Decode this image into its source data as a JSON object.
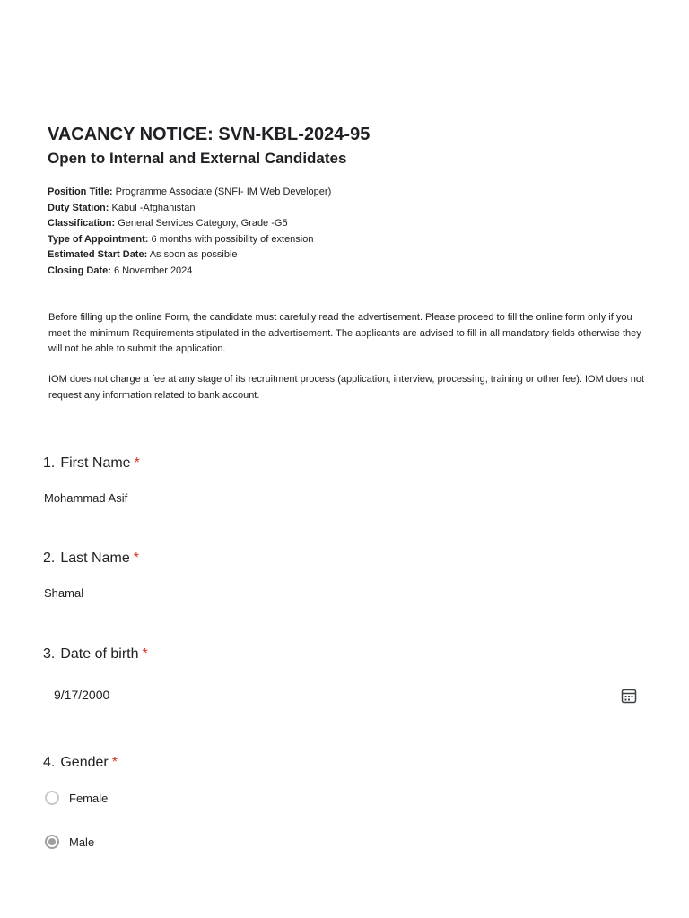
{
  "header": {
    "title_prefix": "VACANCY NOTICE:",
    "title_code": "SVN-KBL-2024-95",
    "subtitle": "Open to Internal and External Candidates"
  },
  "info": [
    {
      "label": "Position Title:",
      "value": "Programme Associate (SNFI- IM Web Developer)"
    },
    {
      "label": "Duty Station:",
      "value": "Kabul -Afghanistan"
    },
    {
      "label": "Classification:",
      "value": "General Services Category, Grade -G5"
    },
    {
      "label": "Type of Appointment:",
      "value": "6 months with possibility of extension"
    },
    {
      "label": "Estimated Start Date:",
      "value": "As soon as possible"
    },
    {
      "label": "Closing Date:",
      "value": "6 November 2024"
    }
  ],
  "paragraphs": {
    "p1": "Before filling up the online Form, the candidate must carefully read the advertisement. Please proceed to fill the online form only if you meet the minimum Requirements stipulated in the advertisement. The applicants are advised to fill in all mandatory fields otherwise they will not be able to submit the application.",
    "p2": "IOM does not charge a fee at any stage of its recruitment process (application, interview, processing, training or other fee). IOM does not request any information related to bank account."
  },
  "questions": {
    "q1": {
      "num": "1.",
      "label": "First Name",
      "required": "*",
      "value": "Mohammad Asif"
    },
    "q2": {
      "num": "2.",
      "label": "Last Name",
      "required": "*",
      "value": "Shamal"
    },
    "q3": {
      "num": "3.",
      "label": "Date of birth",
      "required": "*",
      "value": "9/17/2000",
      "icon": "calendar-icon"
    },
    "q4": {
      "num": "4.",
      "label": "Gender",
      "required": "*",
      "options": [
        "Female",
        "Male"
      ],
      "selected": "Male"
    }
  },
  "colors": {
    "required": "#d93025",
    "text": "#202124",
    "radio_selected": "#9e9e9e"
  }
}
